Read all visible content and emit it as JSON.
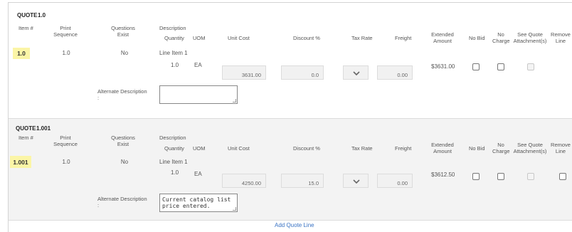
{
  "corner_badge": "C",
  "headers": {
    "item": "Item #",
    "print_sequence": [
      "Print",
      "Sequence"
    ],
    "questions_exist": [
      "Questions",
      "Exist"
    ],
    "description": "Description",
    "quantity": "Quantity",
    "uom": "UOM",
    "unit_cost": "Unit Cost",
    "discount": "Discount %",
    "tax_rate": "Tax Rate",
    "freight": "Freight",
    "extended_amount": [
      "Extended",
      "Amount"
    ],
    "no_bid": "No Bid",
    "no_charge": [
      "No",
      "Charge"
    ],
    "see_quote": [
      "See Quote",
      "Attachment(s)"
    ],
    "remove_line": [
      "Remove",
      "Line"
    ],
    "alternate_description": "Alternate Description",
    "colon": ":"
  },
  "quotes": [
    {
      "label": "QUOTE",
      "number": "1.0",
      "item": "1.0",
      "print_sequence": "1.0",
      "questions_exist": "No",
      "line_description": "Line Item 1",
      "quantity": "1.0",
      "uom": "EA",
      "unit_cost": "3631.00",
      "discount": "0.0",
      "freight": "0.00",
      "extended_amount": "$3631.00",
      "alternate_description": ""
    },
    {
      "label": "QUOTE",
      "number": "1.001",
      "item": "1.001",
      "print_sequence": "1.0",
      "questions_exist": "No",
      "line_description": "Line Item 1",
      "quantity": "1.0",
      "uom": "EA",
      "unit_cost": "4250.00",
      "discount": "15.0",
      "freight": "0.00",
      "extended_amount": "$3612.50",
      "alternate_description": "Current catalog list price entered."
    }
  ],
  "add_quote_line": "Add Quote Line",
  "colors": {
    "item_highlight": "#fbf5a6",
    "badge": "#e34b3a",
    "link": "#3b74c4",
    "alt_row": "#f3f3f3"
  },
  "icons": {
    "tax_rate_dropdown": "chevron-down-icon"
  }
}
